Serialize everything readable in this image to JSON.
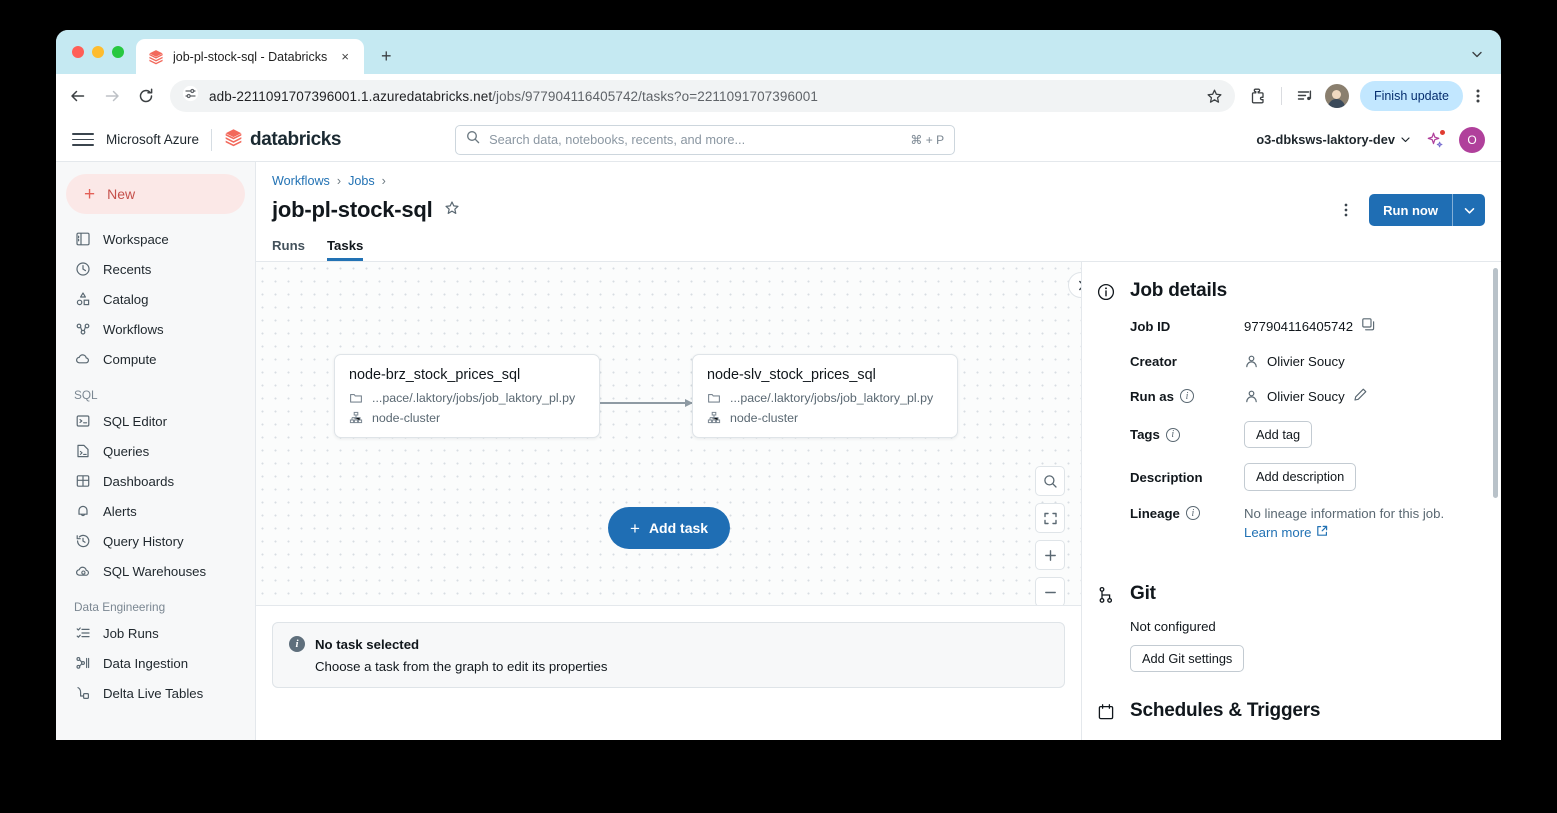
{
  "browser": {
    "tab": {
      "title": "job-pl-stock-sql - Databricks",
      "favicon": "databricks-logo-icon",
      "close": "×",
      "new_tab": "+"
    },
    "toolbar": {
      "back": "back-icon",
      "forward": "forward-icon",
      "reload": "reload-icon",
      "url_main": "adb-2211091707396001.1.azuredatabricks.net",
      "url_path": "/jobs/977904116405742/tasks?o=2211091707396001",
      "finish_update": "Finish update"
    }
  },
  "app_header": {
    "azure": "Microsoft Azure",
    "brand": "databricks",
    "search_placeholder": "Search data, notebooks, recents, and more...",
    "search_shortcut": "⌘ + P",
    "workspace": "o3-dbksws-laktory-dev",
    "avatar_initial": "O"
  },
  "sidebar": {
    "new_label": "New",
    "items": [
      {
        "label": "Workspace",
        "icon": "workspace-icon"
      },
      {
        "label": "Recents",
        "icon": "clock-icon"
      },
      {
        "label": "Catalog",
        "icon": "catalog-icon"
      },
      {
        "label": "Workflows",
        "icon": "workflows-icon"
      },
      {
        "label": "Compute",
        "icon": "cloud-icon"
      }
    ],
    "group_sql": "SQL",
    "sql_items": [
      {
        "label": "SQL Editor",
        "icon": "sql-editor-icon"
      },
      {
        "label": "Queries",
        "icon": "queries-icon"
      },
      {
        "label": "Dashboards",
        "icon": "dashboards-icon"
      },
      {
        "label": "Alerts",
        "icon": "bell-icon"
      },
      {
        "label": "Query History",
        "icon": "history-icon"
      },
      {
        "label": "SQL Warehouses",
        "icon": "warehouse-icon"
      }
    ],
    "group_de": "Data Engineering",
    "de_items": [
      {
        "label": "Job Runs",
        "icon": "job-runs-icon"
      },
      {
        "label": "Data Ingestion",
        "icon": "data-ingestion-icon"
      },
      {
        "label": "Delta Live Tables",
        "icon": "delta-live-tables-icon"
      }
    ]
  },
  "page": {
    "breadcrumb": [
      "Workflows",
      "Jobs"
    ],
    "title": "job-pl-stock-sql",
    "favorite_icon": "star-icon",
    "kebab_icon": "more-vertical-icon",
    "run_now": "Run now",
    "run_now_chevron": "chevron-down-icon",
    "tabs": [
      {
        "label": "Runs",
        "active": false
      },
      {
        "label": "Tasks",
        "active": true
      }
    ]
  },
  "graph": {
    "nodes": [
      {
        "title": "node-brz_stock_prices_sql",
        "path": "...pace/.laktory/jobs/job_laktory_pl.py",
        "cluster": "node-cluster"
      },
      {
        "title": "node-slv_stock_prices_sql",
        "path": "...pace/.laktory/jobs/job_laktory_pl.py",
        "cluster": "node-cluster"
      }
    ],
    "add_task": "Add task",
    "controls": [
      "search-icon",
      "fit-screen-icon",
      "zoom-in-icon",
      "zoom-out-icon"
    ],
    "collapse_icon": "chevron-right-icon"
  },
  "no_task": {
    "title": "No task selected",
    "subtitle": "Choose a task from the graph to edit its properties"
  },
  "details": {
    "heading": "Job details",
    "heading_icon": "info-circle-icon",
    "job_id_label": "Job ID",
    "job_id_value": "977904116405742",
    "copy_icon": "copy-icon",
    "creator_label": "Creator",
    "creator_value": "Olivier Soucy",
    "run_as_label": "Run as",
    "run_as_value": "Olivier Soucy",
    "edit_icon": "pencil-icon",
    "tags_label": "Tags",
    "add_tag": "Add tag",
    "description_label": "Description",
    "add_description": "Add description",
    "lineage_label": "Lineage",
    "lineage_value": "No lineage information for this job.",
    "learn_more": "Learn more",
    "external_icon": "external-link-icon",
    "git_heading": "Git",
    "git_icon": "git-branch-icon",
    "git_status": "Not configured",
    "git_button": "Add Git settings",
    "schedules_heading": "Schedules & Triggers",
    "schedules_icon": "calendar-icon"
  },
  "colors": {
    "accent_blue": "#2272b4",
    "primary_button": "#1f6eb4",
    "brand_red": "#e35f57",
    "avatar": "#b0409b",
    "tab_strip": "#c5e9f2"
  }
}
